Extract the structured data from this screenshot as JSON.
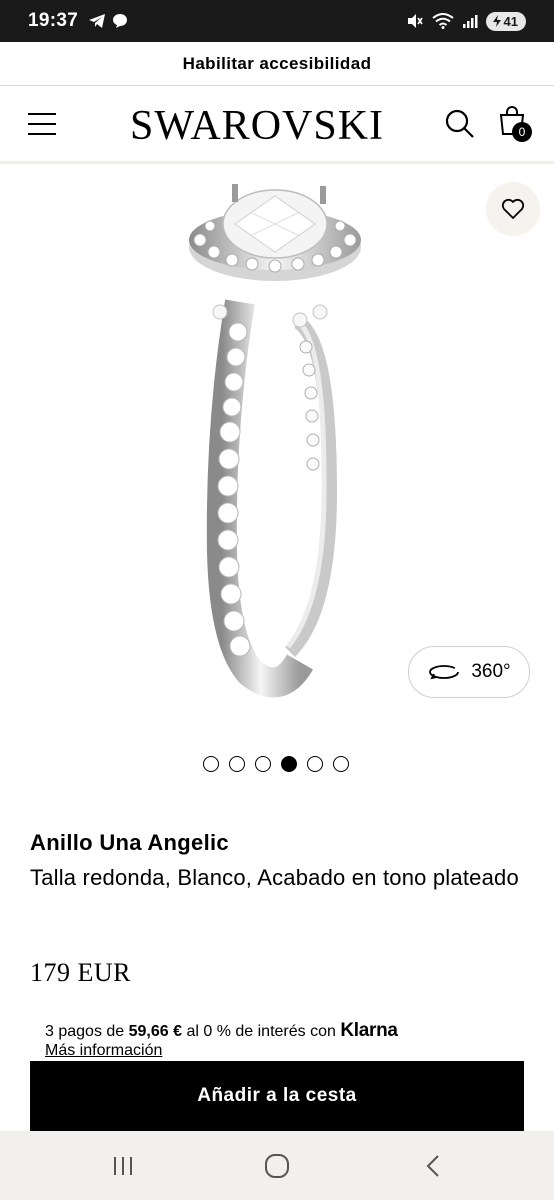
{
  "status_bar": {
    "time": "19:37",
    "battery": "41"
  },
  "accessibility": {
    "label": "Habilitar accesibilidad"
  },
  "header": {
    "logo": "SWAROVSKI",
    "cart_count": "0"
  },
  "gallery": {
    "view360_label": "360°",
    "slides": 6,
    "active_slide": 4
  },
  "product": {
    "name": "Anillo Una Angelic",
    "description": "Talla redonda, Blanco, Acabado en tono plateado",
    "price": "179 EUR"
  },
  "klarna": {
    "prefix": "3 pagos de ",
    "amount": "59,66 €",
    "suffix": " al 0 % de interés con ",
    "brand": "Klarna",
    "more_info": "Más información"
  },
  "cta": {
    "add_to_cart": "Añadir a la cesta"
  },
  "colors": {
    "accent_bar": "#f3eee8",
    "button": "#000000"
  }
}
